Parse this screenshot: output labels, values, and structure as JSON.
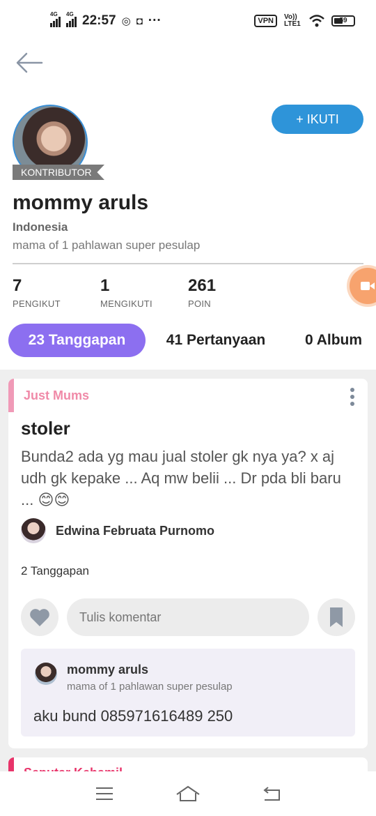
{
  "status_bar": {
    "network1": "4G",
    "network2": "4G",
    "time": "22:57",
    "more": "···",
    "vpn": "VPN",
    "volte": "Vo)) LTE1",
    "battery": "59"
  },
  "profile": {
    "badge": "KONTRIBUTOR",
    "follow_button": "+ IKUTI",
    "name": "mommy aruls",
    "country": "Indonesia",
    "bio": "mama of 1 pahlawan super pesulap",
    "stats": [
      {
        "value": "7",
        "label": "PENGIKUT"
      },
      {
        "value": "1",
        "label": "MENGIKUTI"
      },
      {
        "value": "261",
        "label": "POIN"
      }
    ]
  },
  "tabs": [
    {
      "label": "23 Tanggapan",
      "active": true
    },
    {
      "label": "41 Pertanyaan",
      "active": false
    },
    {
      "label": "0 Album",
      "active": false
    }
  ],
  "post": {
    "category": "Just Mums",
    "title": "stoler",
    "body": "Bunda2 ada yg mau jual stoler gk nya ya? x aj udh gk kepake ... Aq mw belii ... Dr pda bli baru ... 😊😊",
    "author": "Edwina Februata Purnomo",
    "reply_count": "2 Tanggapan",
    "comment_placeholder": "Tulis komentar",
    "reply": {
      "name": "mommy aruls",
      "bio": "mama of 1 pahlawan super pesulap",
      "text": "aku bund 085971616489  250"
    }
  },
  "next_post": {
    "category": "Seputar Kehamil..."
  },
  "colors": {
    "accent_purple": "#8c6ff0",
    "follow_blue": "#2e94d9",
    "category_pink": "#f08aa8"
  }
}
